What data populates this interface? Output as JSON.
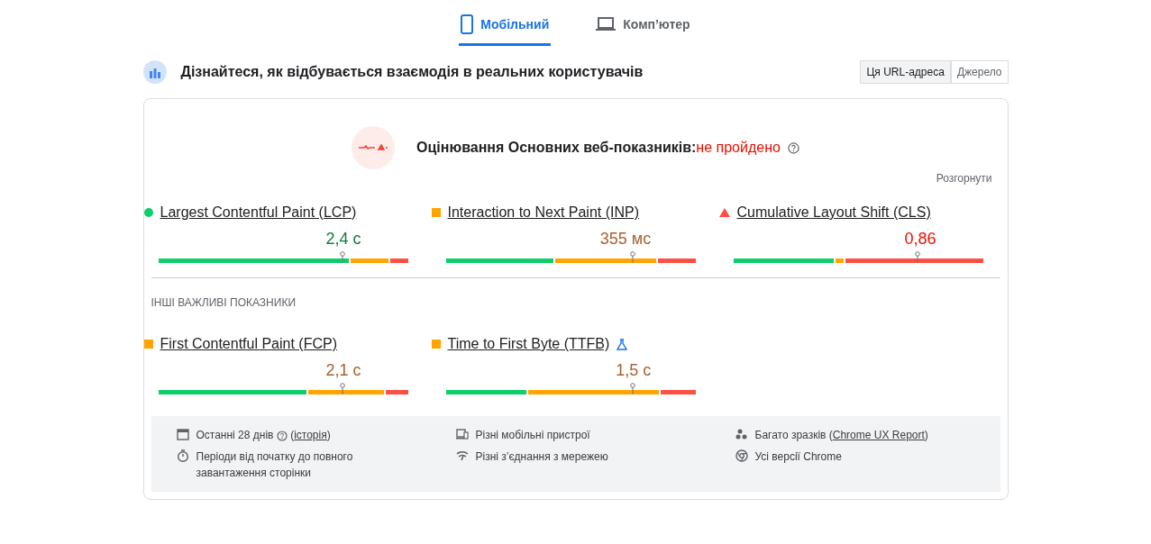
{
  "device_tabs": [
    {
      "label": "Мобільний",
      "kind": "mobile",
      "selected": true
    },
    {
      "label": "Комп’ютер",
      "kind": "desktop",
      "selected": false
    }
  ],
  "header": {
    "title": "Дізнайтеся, як відбувається взаємодія в реальних користувачів",
    "toggle": [
      {
        "label": "Ця URL-адреса",
        "selected": true
      },
      {
        "label": "Джерело",
        "selected": false
      }
    ]
  },
  "assessment": {
    "label": "Оцінювання Основних веб-показників:",
    "result": "не пройдено",
    "expand": "Розгорнути"
  },
  "core_metrics": [
    {
      "name": "Largest Contentful Paint (LCP)",
      "kind": "good",
      "value": "2,4 с",
      "marker": {
        "level": 0.74
      },
      "fills": [
        {
          "kind": "average",
          "level": 0.93
        },
        {
          "kind": "good",
          "level": 0.77
        }
      ]
    },
    {
      "name": "Interaction to Next Paint (INP)",
      "kind": "average",
      "value": "355 мс",
      "marker": {
        "level": 0.75
      },
      "fills": [
        {
          "kind": "average",
          "level": 0.85
        },
        {
          "kind": "good",
          "level": 0.44
        }
      ]
    },
    {
      "name": "Cumulative Layout Shift (CLS)",
      "kind": "poor",
      "value": "0,86",
      "marker": {
        "level": 0.74
      },
      "fills": [
        {
          "kind": "average",
          "level": 0.45
        },
        {
          "kind": "good",
          "level": 0.41
        }
      ]
    }
  ],
  "other_heading": "ІНШІ ВАЖЛИВІ ПОКАЗНИКИ",
  "other_metrics": [
    {
      "name": "First Contentful Paint (FCP)",
      "kind": "average",
      "value": "2,1 с",
      "experimental": false,
      "marker": {
        "level": 0.74
      },
      "fills": [
        {
          "kind": "average",
          "level": 0.91
        },
        {
          "kind": "good",
          "level": 0.6
        }
      ]
    },
    {
      "name": "Time to First Byte (TTFB)",
      "kind": "average",
      "value": "1,5 с",
      "experimental": true,
      "marker": {
        "level": 0.75
      },
      "fills": [
        {
          "kind": "average",
          "level": 0.86
        },
        {
          "kind": "good",
          "level": 0.33
        }
      ]
    }
  ],
  "footer": [
    {
      "kind": "calendar",
      "text": "Останні 28 днів",
      "help": true,
      "before": "(",
      "link": "історія",
      "after": ")"
    },
    {
      "kind": "devices",
      "text": "Різні мобільні пристрої"
    },
    {
      "kind": "samples",
      "text": "Багато зразків (",
      "link": "Chrome UX Report",
      "after": ")"
    },
    {
      "kind": "timer",
      "text": "Періоди від початку до повного завантаження сторінки"
    },
    {
      "kind": "network",
      "text": "Різні з’єднання з мережею"
    },
    {
      "kind": "chrome",
      "text": "Усі версії Chrome"
    }
  ]
}
